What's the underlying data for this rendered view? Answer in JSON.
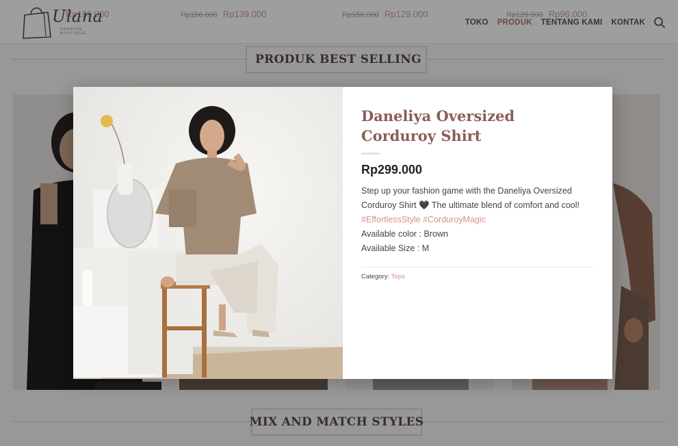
{
  "header": {
    "logo_text": "Ulana",
    "logo_subtext": "FASHION BOUTIQUE",
    "ghost_prices": [
      {
        "old": "",
        "new": "Rp139.000"
      },
      {
        "old": "Rp156.000",
        "new": "Rp139.000"
      },
      {
        "old": "Rp156.000",
        "new": "Rp129.000"
      },
      {
        "old": "Rp129.000",
        "new": "Rp96.000"
      }
    ],
    "nav": [
      {
        "label": "TOKO",
        "active": false
      },
      {
        "label": "PRODUK",
        "active": true
      },
      {
        "label": "TENTANG KAMI",
        "active": false
      },
      {
        "label": "KONTAK",
        "active": false
      }
    ],
    "search_icon": "search-icon"
  },
  "sections": {
    "best_selling": {
      "title": "PRODUK BEST SELLING",
      "icon": "heart-icon"
    },
    "mix_match": {
      "title": "MIX AND MATCH STYLES"
    }
  },
  "modal": {
    "title": "Daneliya Oversized Corduroy Shirt",
    "price": "Rp299.000",
    "desc_intro": "Step up your fashion game with the Daneliya Oversized Corduroy Shirt",
    "desc_heart": "🖤",
    "desc_mid": "The ultimate blend of comfort and cool!",
    "tag1": "#EffortlessStyle",
    "tag2": "#CorduroyMagic",
    "available_color": "Available color : Brown",
    "available_size": "Available Size : M",
    "category_label": "Category:",
    "category_value": "Tops"
  },
  "colors": {
    "accent": "#b5746c",
    "title": "#8b5d58",
    "link": "#d4918a"
  }
}
